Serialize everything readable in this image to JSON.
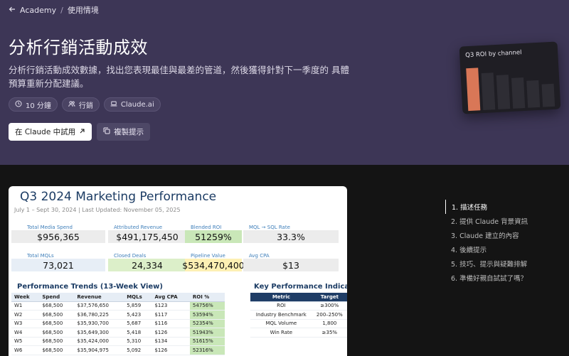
{
  "breadcrumb": {
    "root": "Academy",
    "sep": "/",
    "current": "使用情境"
  },
  "hero": {
    "title": "分析行銷活動成效",
    "description": "分析行銷活動成效數據，找出您表現最佳與最差的管道，然後獲得針對下一季度的 具體預算重新分配建議。",
    "tags": [
      {
        "label": "10 分鐘",
        "icon": "clock-icon"
      },
      {
        "label": "行銷",
        "icon": "people-icon"
      },
      {
        "label": "Claude.ai",
        "icon": "laptop-icon"
      }
    ],
    "primary_button": "在 Claude 中試用",
    "secondary_button": "複製提示"
  },
  "roi_card": {
    "title": "Q3 ROI by channel",
    "bars": [
      {
        "value": 0.86,
        "highlight": true
      },
      {
        "value": 0.74
      },
      {
        "value": 0.68
      },
      {
        "value": 0.62
      },
      {
        "value": 0.54
      },
      {
        "value": 0.46
      }
    ],
    "highlight_color": "#d97757"
  },
  "sheet": {
    "title": "Q3 2024 Marketing Performance",
    "subtitle": "July 1 – Sept 30, 2024 | Last Updated: November 05, 2025",
    "kpis_row1": [
      {
        "label": "Total Media Spend",
        "value": "$956,365",
        "bg": "#ececec"
      },
      {
        "label": "Attributed Revenue",
        "value": "$491,175,450",
        "bg": "#ececec"
      },
      {
        "label": "Blended ROI",
        "value": "51259%",
        "bg": "#c9e7b8"
      },
      {
        "label": "MQL → SQL Rate",
        "value": "33.3%",
        "bg": "#ececec"
      }
    ],
    "kpis_row2": [
      {
        "label": "Total MQLs",
        "value": "73,021",
        "bg": "#e7eef6"
      },
      {
        "label": "Closed Deals",
        "value": "24,334",
        "bg": "#dcefc9"
      },
      {
        "label": "Pipeline Value",
        "value": "$534,470,400",
        "bg": "#fdf0b4"
      },
      {
        "label": "Avg CPA",
        "value": "$13",
        "bg": "#ececec"
      }
    ],
    "trends": {
      "title": "Performance Trends (13-Week View)",
      "headers": [
        "Week",
        "Spend",
        "Revenue",
        "MQLs",
        "Avg CPA",
        "ROI %"
      ],
      "rows": [
        [
          "W1",
          "$68,500",
          "$37,576,650",
          "5,859",
          "$123",
          "54756%"
        ],
        [
          "W2",
          "$68,500",
          "$36,780,225",
          "5,423",
          "$117",
          "53594%"
        ],
        [
          "W3",
          "$68,500",
          "$35,930,700",
          "5,687",
          "$116",
          "52354%"
        ],
        [
          "W4",
          "$68,500",
          "$35,649,300",
          "5,418",
          "$126",
          "51943%"
        ],
        [
          "W5",
          "$68,500",
          "$35,424,000",
          "5,310",
          "$134",
          "51615%"
        ],
        [
          "W6",
          "$68,500",
          "$35,904,975",
          "5,092",
          "$126",
          "52316%"
        ]
      ]
    },
    "kpi_table": {
      "title": "Key Performance Indicators vs",
      "headers": [
        "Metric",
        "Target"
      ],
      "rows": [
        [
          "ROI",
          "≥300%"
        ],
        [
          "Industry Benchmark",
          "200–250%"
        ],
        [
          "MQL Volume",
          "1,800"
        ],
        [
          "Win Rate",
          "≥35%"
        ]
      ]
    }
  },
  "toc": [
    {
      "label": "1. 描述任務",
      "active": true
    },
    {
      "label": "2. 提供 Claude 背景資訊"
    },
    {
      "label": "3. Claude 建立的內容"
    },
    {
      "label": "4. 後續提示"
    },
    {
      "label": "5. 技巧、提示與疑難排解"
    },
    {
      "label": "6. 準備好親自試試了嗎？"
    }
  ]
}
